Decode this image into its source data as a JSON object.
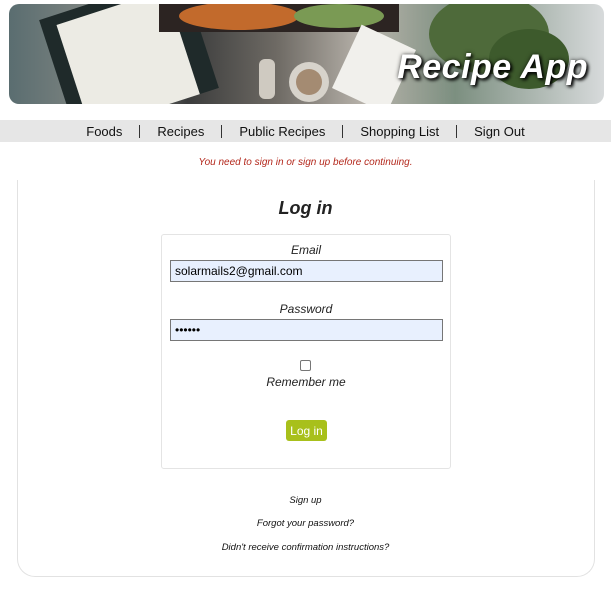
{
  "header": {
    "title": "Recipe App"
  },
  "nav": {
    "items": [
      "Foods",
      "Recipes",
      "Public Recipes",
      "Shopping List",
      "Sign Out"
    ]
  },
  "flash": "You need to sign in or sign up before continuing.",
  "login": {
    "title": "Log in",
    "email_label": "Email",
    "email_value": "solarmails2@gmail.com",
    "password_label": "Password",
    "password_value": "••••••",
    "remember_label": "Remember me",
    "remember_checked": false,
    "submit_label": "Log in"
  },
  "links": {
    "sign_up": "Sign up",
    "forgot_password": "Forgot your password?",
    "confirmation": "Didn't receive confirmation instructions?"
  },
  "colors": {
    "accent": "#a8c01b",
    "flash": "#b3271b",
    "nav_bg": "#e6e6e6",
    "input_bg": "#e8f0fe"
  }
}
